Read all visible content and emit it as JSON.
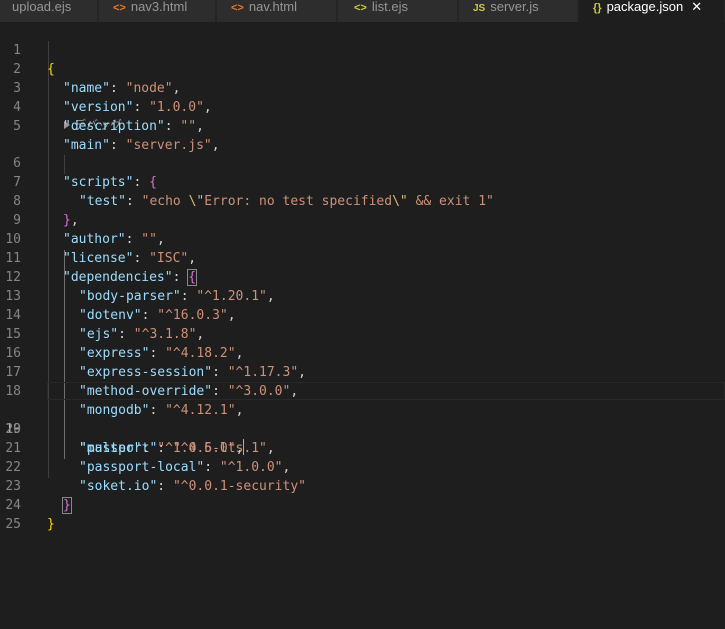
{
  "tabs": [
    {
      "label": "upload.ejs",
      "icon": "ejs"
    },
    {
      "label": "nav3.html",
      "icon": "html"
    },
    {
      "label": "nav.html",
      "icon": "html"
    },
    {
      "label": "list.ejs",
      "icon": "ejs"
    },
    {
      "label": "server.js",
      "icon": "js"
    },
    {
      "label": "package.json",
      "icon": "json",
      "active": true
    }
  ],
  "tab_icons": {
    "html": "<>",
    "ejs": "<>",
    "js": "JS",
    "json": "{}"
  },
  "close_glyph": "✕",
  "codelens": {
    "label": "デバッグ"
  },
  "line_numbers": [
    "1",
    "2",
    "3",
    "4",
    "5",
    "6",
    "7",
    "8",
    "9",
    "10",
    "11",
    "12",
    "13",
    "14",
    "15",
    "16",
    "17",
    "18",
    "19",
    "20",
    "21",
    "22",
    "23",
    "24",
    "25"
  ],
  "lines": {
    "l1": {
      "open": "{"
    },
    "l2": {
      "key": "\"name\"",
      "sep": ": ",
      "value": "\"node\"",
      "trail": ","
    },
    "l3": {
      "key": "\"version\"",
      "sep": ": ",
      "value": "\"1.0.0\"",
      "trail": ","
    },
    "l4": {
      "key": "\"description\"",
      "sep": ": ",
      "value": "\"\"",
      "trail": ","
    },
    "l5": {
      "key": "\"main\"",
      "sep": ": ",
      "value": "\"server.js\"",
      "trail": ","
    },
    "l6": {
      "key": "\"scripts\"",
      "sep": ": ",
      "open": "{"
    },
    "l7": {
      "key": "\"test\"",
      "sep": ": ",
      "v1": "\"echo ",
      "e1": "\\\"",
      "v2": "Error: no test specified",
      "e2": "\\\"",
      "v3": " && exit 1\""
    },
    "l8": {
      "close": "}",
      "trail": ","
    },
    "l9": {
      "key": "\"author\"",
      "sep": ": ",
      "value": "\"\"",
      "trail": ","
    },
    "l10": {
      "key": "\"license\"",
      "sep": ": ",
      "value": "\"ISC\"",
      "trail": ","
    },
    "l11": {
      "key": "\"dependencies\"",
      "sep": ": ",
      "open": "{"
    },
    "l12": {
      "key": "\"body-parser\"",
      "sep": ": ",
      "value": "\"^1.20.1\"",
      "trail": ","
    },
    "l13": {
      "key": "\"dotenv\"",
      "sep": ": ",
      "value": "\"^16.0.3\"",
      "trail": ","
    },
    "l14": {
      "key": "\"ejs\"",
      "sep": ": ",
      "value": "\"^3.1.8\"",
      "trail": ","
    },
    "l15": {
      "key": "\"express\"",
      "sep": ": ",
      "value": "\"^4.18.2\"",
      "trail": ","
    },
    "l16": {
      "key": "\"express-session\"",
      "sep": ": ",
      "value": "\"^1.17.3\"",
      "trail": ","
    },
    "l17": {
      "key": "\"method-override\"",
      "sep": ": ",
      "value": "\"^3.0.0\"",
      "trail": ","
    },
    "l18": {
      "key": "\"mongodb\"",
      "sep": ": ",
      "value": "\"^4.12.1\"",
      "trail": ","
    },
    "l19": {
      "key": "\"multer\"",
      "sep": ": ",
      "value_a": "\"^1.4.5-lts",
      "value_b": ".1\"",
      "trail": ","
    },
    "l20": {
      "key": "\"passport\"",
      "sep": ": ",
      "value": "\"^0.6.0\"",
      "trail": ","
    },
    "l21": {
      "key": "\"passport-local\"",
      "sep": ": ",
      "value": "\"^1.0.0\"",
      "trail": ","
    },
    "l22": {
      "key": "\"soket.io\"",
      "sep": ": ",
      "value": "\"^0.0.1-security\""
    },
    "l23": {
      "close": "}"
    },
    "l24": {
      "close": "}"
    },
    "l25": {}
  },
  "current_line": "19",
  "colors": {
    "background": "#1e1e1e",
    "tab_inactive": "#2d2d2d",
    "key": "#9cdcfe",
    "string": "#ce9178",
    "escape": "#d7ba7d",
    "bracket_level1": "#ffd700",
    "bracket_level2": "#da70d6",
    "bracket_level3": "#179fff"
  }
}
